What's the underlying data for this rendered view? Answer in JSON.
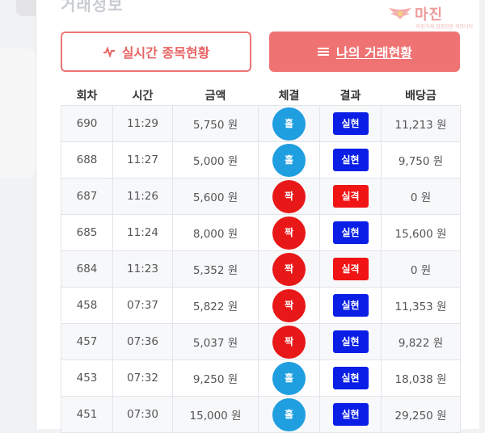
{
  "card": {
    "title": "거래정보"
  },
  "logo": {
    "text": "마진",
    "sub": "마진거래 검증전문 커뮤니티"
  },
  "buttons": {
    "live_label": "실시간 종목현황",
    "my_label": "나의 거래현황"
  },
  "table": {
    "headers": [
      "회차",
      "시간",
      "금액",
      "체결",
      "결과",
      "배당금"
    ],
    "rows": [
      {
        "round": "690",
        "time": "11:29",
        "amount": "5,750 원",
        "pick": "홀",
        "pick_color": "#1f9ee0",
        "result": "실현",
        "result_color": "#0a1ee6",
        "payout": "11,213 원"
      },
      {
        "round": "688",
        "time": "11:27",
        "amount": "5,000 원",
        "pick": "홀",
        "pick_color": "#1f9ee0",
        "result": "실현",
        "result_color": "#0a1ee6",
        "payout": "9,750 원"
      },
      {
        "round": "687",
        "time": "11:26",
        "amount": "5,600 원",
        "pick": "짝",
        "pick_color": "#e81818",
        "result": "실격",
        "result_color": "#f01414",
        "payout": "0 원"
      },
      {
        "round": "685",
        "time": "11:24",
        "amount": "8,000 원",
        "pick": "짝",
        "pick_color": "#e81818",
        "result": "실현",
        "result_color": "#0a1ee6",
        "payout": "15,600 원"
      },
      {
        "round": "684",
        "time": "11:23",
        "amount": "5,352 원",
        "pick": "짝",
        "pick_color": "#e81818",
        "result": "실격",
        "result_color": "#f01414",
        "payout": "0 원"
      },
      {
        "round": "458",
        "time": "07:37",
        "amount": "5,822 원",
        "pick": "짝",
        "pick_color": "#e81818",
        "result": "실현",
        "result_color": "#0a1ee6",
        "payout": "11,353 원"
      },
      {
        "round": "457",
        "time": "07:36",
        "amount": "5,037 원",
        "pick": "짝",
        "pick_color": "#e81818",
        "result": "실현",
        "result_color": "#0a1ee6",
        "payout": "9,822 원"
      },
      {
        "round": "453",
        "time": "07:32",
        "amount": "9,250 원",
        "pick": "홀",
        "pick_color": "#1f9ee0",
        "result": "실현",
        "result_color": "#0a1ee6",
        "payout": "18,038 원"
      },
      {
        "round": "451",
        "time": "07:30",
        "amount": "15,000 원",
        "pick": "홀",
        "pick_color": "#1f9ee0",
        "result": "실현",
        "result_color": "#0a1ee6",
        "payout": "29,250 원"
      }
    ]
  }
}
